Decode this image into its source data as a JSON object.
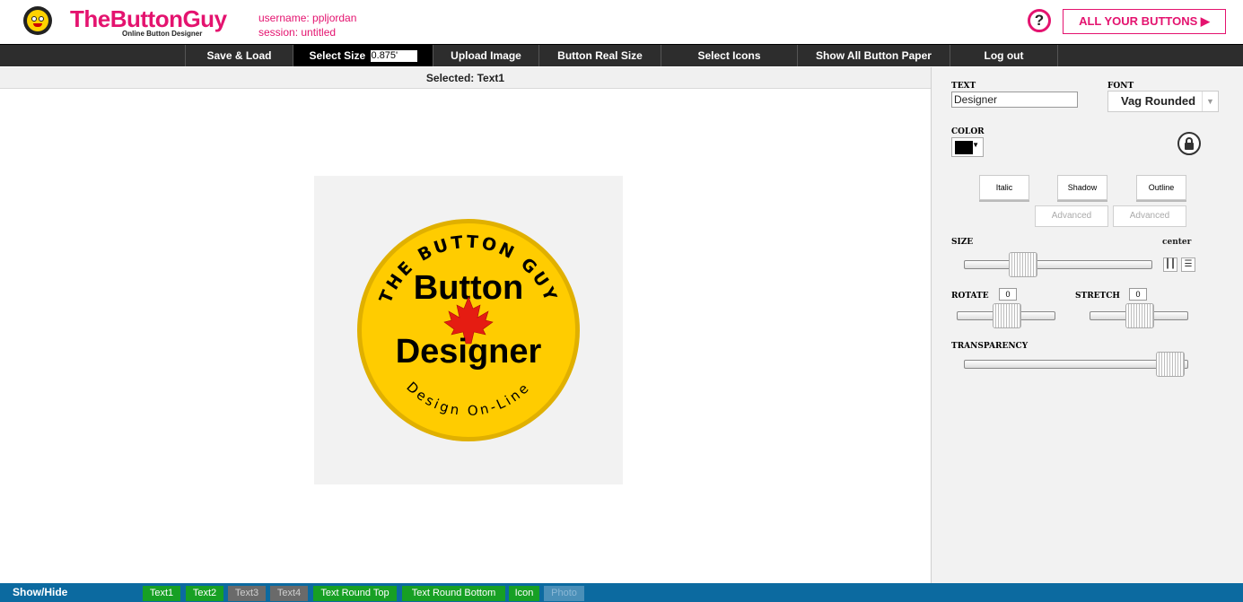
{
  "brand": {
    "title": "TheButtonGuy",
    "subtitle": "Online Button Designer"
  },
  "user": {
    "username": "username: ppljordan",
    "session": "session: untitled"
  },
  "header": {
    "help_label": "?",
    "all_buttons_label": "ALL YOUR BUTTONS ▶"
  },
  "menu": {
    "save_load": "Save & Load",
    "select_size": "Select Size",
    "size_value": "0.875'",
    "upload_image": "Upload Image",
    "button_real_size": "Button Real Size",
    "select_icons": "Select Icons",
    "show_all_button_paper": "Show All Button Paper",
    "log_out": "Log out"
  },
  "canvas": {
    "selected_label": "Selected: Text1",
    "round_top_text": "THE BUTTON GUY",
    "line1": "Button",
    "line2": "Designer",
    "round_bottom_text": "Design On-Line",
    "button_color": "#ffcc00"
  },
  "panel": {
    "text_label": "TEXT",
    "text_value": "Designer",
    "font_label": "FONT",
    "font_value": "Vag Rounded",
    "color_label": "COLOR",
    "color_value": "#000000",
    "italic": "Italic",
    "shadow": "Shadow",
    "outline": "Outline",
    "advanced_1": "Advanced",
    "advanced_2": "Advanced",
    "size_label": "SIZE",
    "center_label": "center",
    "rotate_label": "ROTATE",
    "rotate_value": "0",
    "stretch_label": "STRETCH",
    "stretch_value": "0",
    "transparency_label": "TRANSPARENCY"
  },
  "bottom": {
    "show_hide": "Show/Hide",
    "toggles": [
      {
        "label": "Text1",
        "state": "on"
      },
      {
        "label": "Text2",
        "state": "on"
      },
      {
        "label": "Text3",
        "state": "off"
      },
      {
        "label": "Text4",
        "state": "off"
      },
      {
        "label": "Text Round Top",
        "state": "on"
      },
      {
        "label": "Text Round Bottom",
        "state": "on"
      },
      {
        "label": "Icon",
        "state": "on"
      },
      {
        "label": "Photo",
        "state": "disabled"
      }
    ]
  },
  "colors": {
    "brand_pink": "#e4136f",
    "toggle_on": "#17a024",
    "toggle_off": "#6a6a6a",
    "bottom_bar": "#0c6aa0",
    "leaf": "#e51c12"
  },
  "icons": [
    "logo-face-icon",
    "help-icon",
    "lock-icon",
    "maple-leaf-icon",
    "align-center-vertical-icon",
    "align-center-horizontal-icon",
    "dropdown-arrow-icon"
  ]
}
